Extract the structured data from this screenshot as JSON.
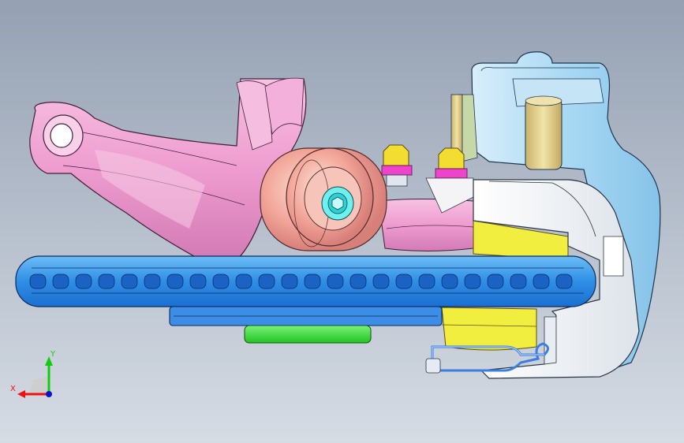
{
  "viewport": {
    "background_top": "#95a1b3",
    "background_bottom": "#d6dce4"
  },
  "model_parts": [
    {
      "name": "steering-knuckle",
      "color": "#f0a0d0"
    },
    {
      "name": "hub-bearing",
      "color": "#f4a9a0"
    },
    {
      "name": "hub-bolt",
      "color": "#40e0e0"
    },
    {
      "name": "brake-disc",
      "color": "#3399ee"
    },
    {
      "name": "wheel-hub-flange",
      "color": "#55aaee"
    },
    {
      "name": "hub-cap",
      "color": "#33dd33"
    },
    {
      "name": "caliper-bracket",
      "color": "#f2f2f2"
    },
    {
      "name": "caliper-body",
      "color": "#a8daf4"
    },
    {
      "name": "caliper-piston",
      "color": "#e6d490"
    },
    {
      "name": "brake-pad",
      "color": "#f2ee40"
    },
    {
      "name": "mounting-bolt",
      "color": "#f2dd30"
    },
    {
      "name": "brake-line",
      "color": "#3a7ee0"
    }
  ],
  "triad": {
    "x_label": "X",
    "y_label": "Y",
    "x_color": "#ee1111",
    "y_color": "#11cc11",
    "z_color": "#1111cc"
  }
}
